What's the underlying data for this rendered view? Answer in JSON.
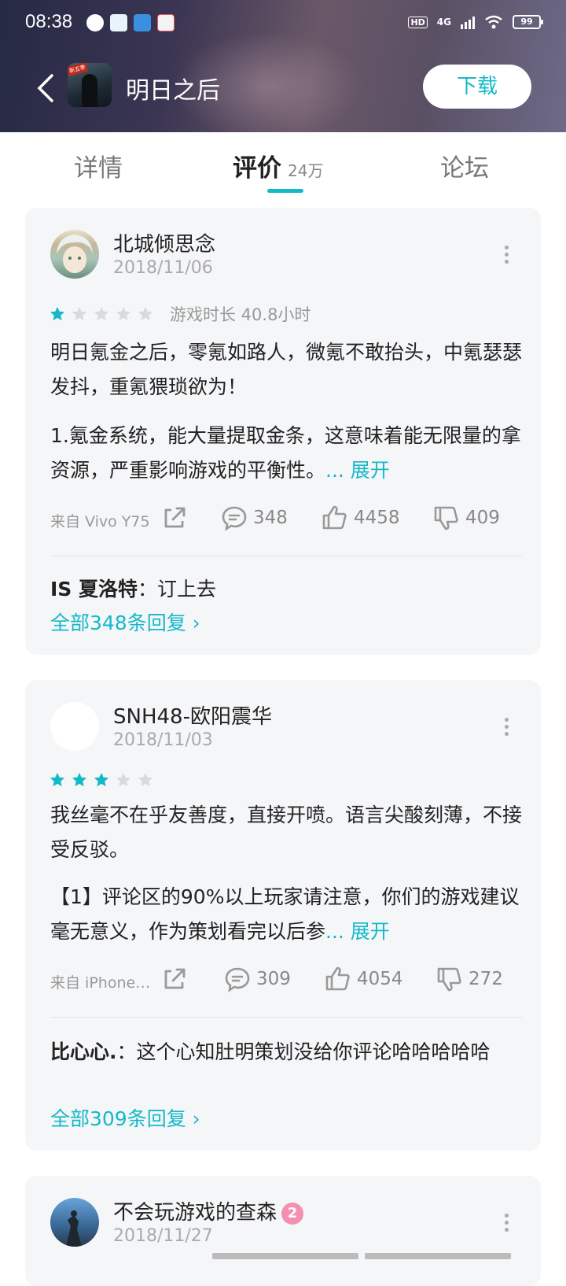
{
  "status": {
    "time": "08:38",
    "battery": "99",
    "network": "4G",
    "hd": "HD"
  },
  "app": {
    "title": "明日之后",
    "download": "下载",
    "icon_tag": "新五季"
  },
  "tabs": [
    {
      "label": "详情"
    },
    {
      "label": "评价",
      "count": "24万"
    },
    {
      "label": "论坛"
    }
  ],
  "reviews": [
    {
      "user": "北城倾思念",
      "date": "2018/11/06",
      "stars": 1,
      "playtime": "游戏时长 40.8小时",
      "para1": "明日氪金之后，零氪如路人，微氪不敢抬头，中氪瑟瑟发抖，重氪猥琐欲为！",
      "para2": "1.氪金系统，能大量提取金条，这意味着能无限量的拿资源，严重影响游戏的平衡性。",
      "expand": "... 展开",
      "source": "来自 Vivo Y75",
      "comments": "348",
      "likes": "4458",
      "dislikes": "409",
      "reply_user": "IS 夏洛特",
      "reply_text": "：订上去",
      "all_replies": "全部348条回复 ›"
    },
    {
      "user": "SNH48-欧阳震华",
      "date": "2018/11/03",
      "stars": 3,
      "para1": "我丝毫不在乎友善度，直接开喷。语言尖酸刻薄，不接受反驳。",
      "para2": "【1】评论区的90%以上玩家请注意，你们的游戏建议毫无意义，作为策划看完以后参",
      "expand": "... 展开",
      "source": "来自 iPhone…",
      "comments": "309",
      "likes": "4054",
      "dislikes": "272",
      "reply_user": "比心心.",
      "reply_text": "：这个心知肚明策划没给你评论哈哈哈哈哈",
      "all_replies": "全部309条回复 ›"
    },
    {
      "user": "不会玩游戏的查森",
      "badge": "2",
      "date": "2018/11/27"
    }
  ]
}
